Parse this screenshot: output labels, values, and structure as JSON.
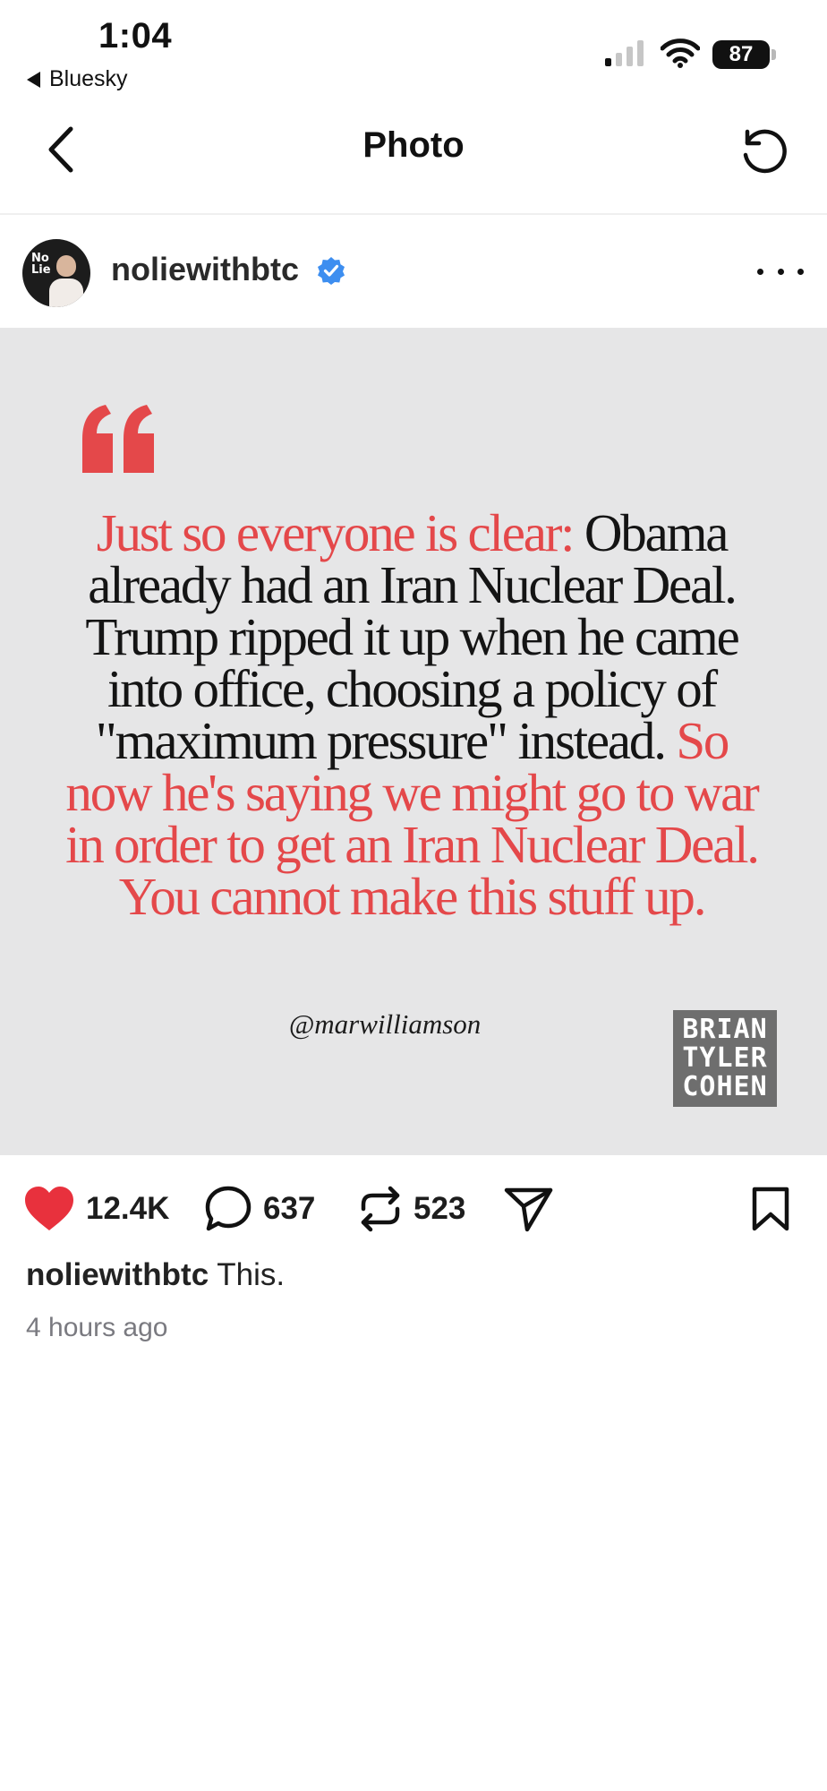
{
  "status_bar": {
    "time": "1:04",
    "back_app": "Bluesky",
    "battery": "87"
  },
  "nav": {
    "title": "Photo"
  },
  "post": {
    "username": "noliewithbtc",
    "avatar_logo": "No Lie",
    "image": {
      "quote_highlight_1": "Just so everyone is clear:",
      "quote_body": " Obama already had an Iran Nuclear Deal. Trump ripped it up when he came into office, choosing a policy of \"maximum pressure\" instead. ",
      "quote_highlight_2": "So now he's saying we might go to war in order to get an Iran Nuclear Deal. You cannot make this stuff up.",
      "credit": "@marwilliamson",
      "logo_lines": [
        "BRIAN",
        "TYLER",
        "COHEN"
      ]
    },
    "actions": {
      "likes": "12.4K",
      "comments": "637",
      "reposts": "523"
    },
    "caption_user": "noliewithbtc",
    "caption_text": "This.",
    "timestamp": "4 hours ago"
  },
  "colors": {
    "accent_red": "#e4484a",
    "like_red": "#e8313d",
    "verified_blue": "#3d8ef0",
    "image_bg": "#e6e6e7"
  },
  "icons": [
    "back-chevron-icon",
    "refresh-icon",
    "verified-badge-icon",
    "more-dots-icon",
    "heart-icon",
    "comment-icon",
    "repost-icon",
    "share-icon",
    "bookmark-icon",
    "wifi-icon",
    "signal-icon"
  ]
}
